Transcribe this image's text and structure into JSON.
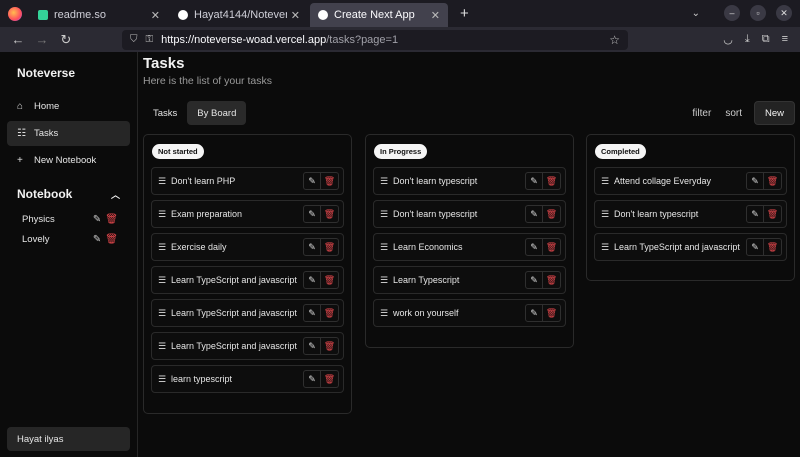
{
  "browser": {
    "tabs": [
      {
        "title": "readme.so",
        "fav_color": "#34d399"
      },
      {
        "title": "Hayat4144/Noteverse: N",
        "fav_color": "#ffffff"
      },
      {
        "title": "Create Next App",
        "fav_color": "#ffffff"
      }
    ],
    "url_main": "https://noteverse-woad.vercel.app",
    "url_rest": "/tasks?page=1"
  },
  "sidebar": {
    "brand": "Noteverse",
    "nav": [
      {
        "label": "Home",
        "icon": "home-icon"
      },
      {
        "label": "Tasks",
        "icon": "list-icon"
      },
      {
        "label": "New Notebook",
        "icon": "plus-icon"
      }
    ],
    "notebook_heading": "Notebook",
    "notebooks": [
      "Physics",
      "Lovely"
    ],
    "user": "Hayat ilyas"
  },
  "page": {
    "title": "Tasks",
    "subtitle": "Here is the list of your tasks",
    "tabs": [
      "Tasks",
      "By Board"
    ],
    "filter": "filter",
    "sort": "sort",
    "new": "New"
  },
  "board": {
    "columns": [
      {
        "name": "Not started",
        "cards": [
          "Don't learn PHP",
          "Exam preparation",
          "Exercise daily",
          "Learn TypeScript and javascript",
          "Learn TypeScript and javascript",
          "Learn TypeScript and javascript",
          "learn typescript"
        ]
      },
      {
        "name": "In Progress",
        "cards": [
          "Don't learn typescript",
          "Don't learn typescript",
          "Learn Economics",
          "Learn Typescript",
          "work on yourself"
        ]
      },
      {
        "name": "Completed",
        "cards": [
          "Attend collage Everyday",
          "Don't learn typescript",
          "Learn TypeScript and javascript"
        ]
      }
    ]
  }
}
